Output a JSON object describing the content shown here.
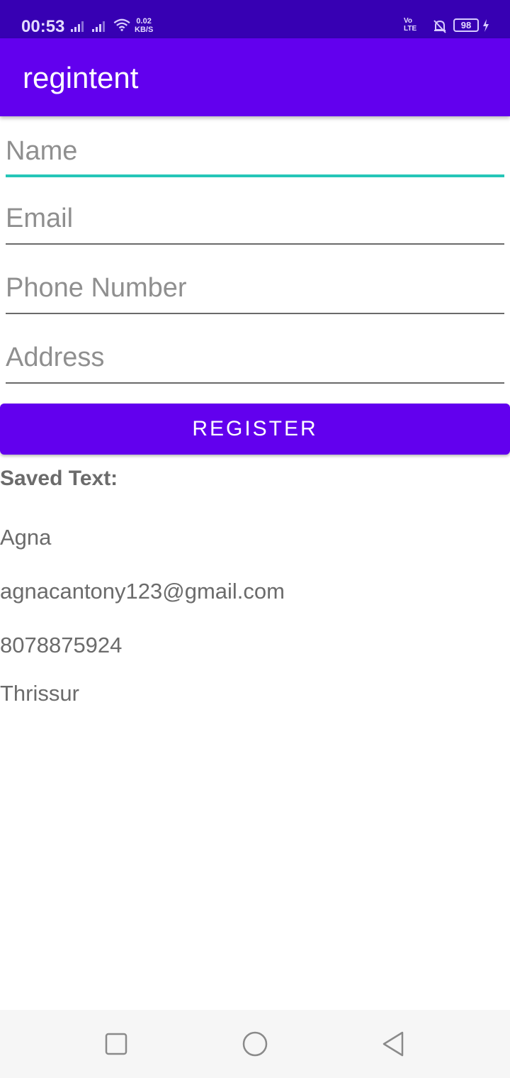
{
  "status_bar": {
    "time": "00:53",
    "net_speed_value": "0.02",
    "net_speed_unit": "KB/S",
    "volte_top": "Vo",
    "volte_bottom": "LTE",
    "battery": "98"
  },
  "app_bar": {
    "title": "regintent"
  },
  "form": {
    "name_placeholder": "Name",
    "email_placeholder": "Email",
    "phone_placeholder": "Phone Number",
    "address_placeholder": "Address",
    "register_label": "REGISTER"
  },
  "saved": {
    "title": "Saved Text:",
    "values": [
      "Agna",
      "agnacantony123@gmail.com",
      "8078875924",
      "Thrissur"
    ]
  },
  "colors": {
    "primary": "#6200ee",
    "primary_dark": "#3700b3",
    "focus_accent": "#26c6b8"
  }
}
